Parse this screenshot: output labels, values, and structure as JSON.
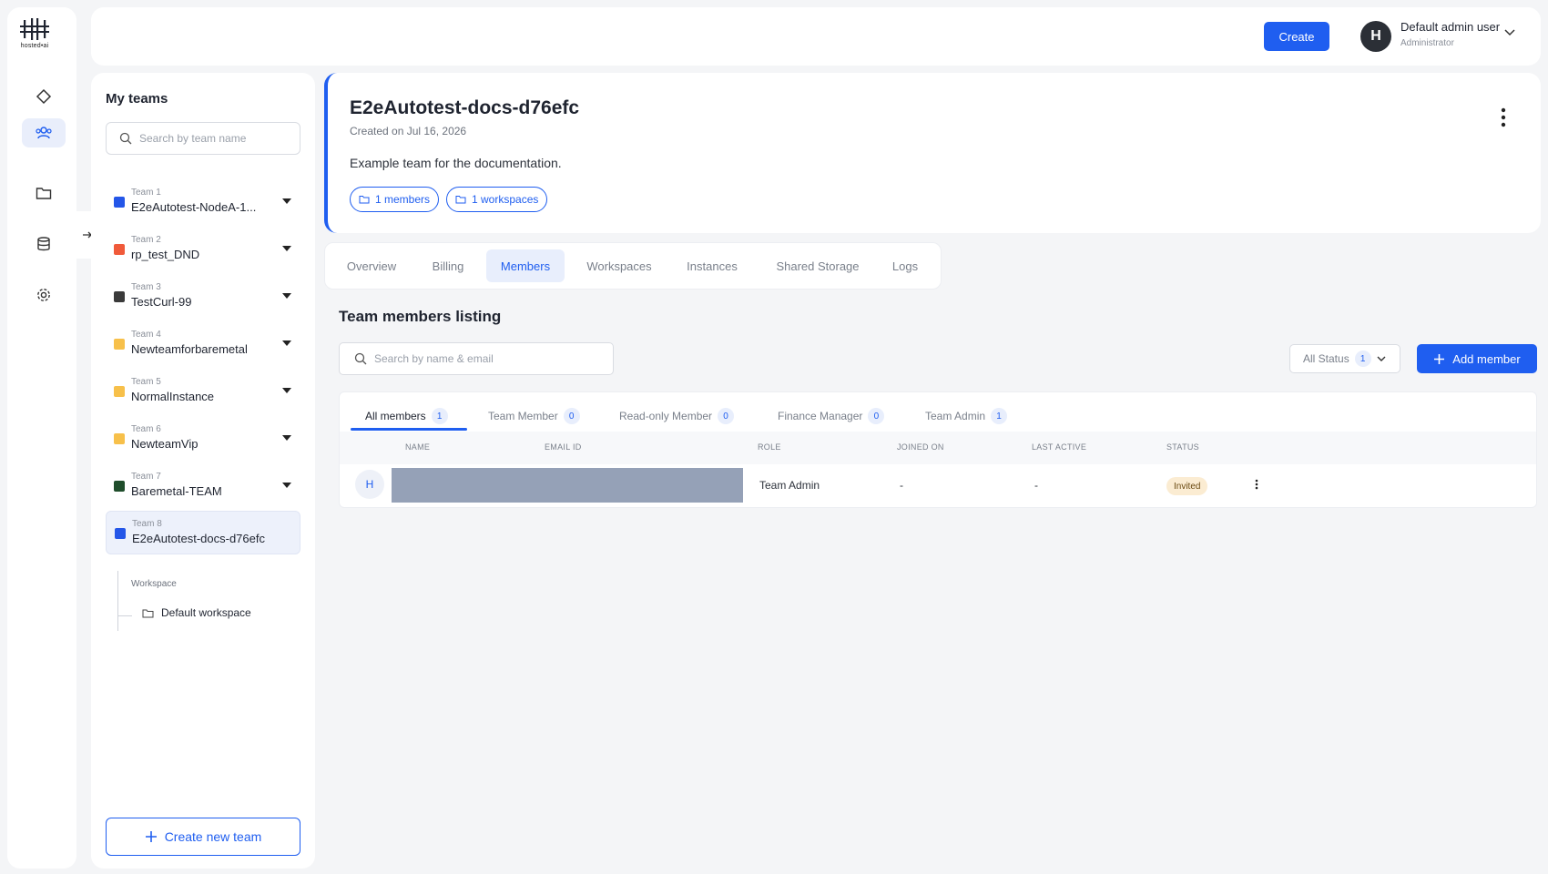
{
  "app": {
    "logo_text": "hosted•ai"
  },
  "rail": {
    "items": [
      {
        "icon": "diamond-icon"
      },
      {
        "icon": "users-icon",
        "active": true
      },
      {
        "icon": "folder-icon"
      },
      {
        "icon": "storage-icon"
      },
      {
        "icon": "gear-icon"
      }
    ]
  },
  "header": {
    "create_label": "Create",
    "avatar_initial": "H",
    "user_name": "Default admin user",
    "user_role": "Administrator"
  },
  "teams_panel": {
    "title": "My teams",
    "search_placeholder": "Search by team name",
    "teams": [
      {
        "label": "Team 1",
        "name": "E2eAutotest-NodeA-1...",
        "color": "#2456e8"
      },
      {
        "label": "Team 2",
        "name": "rp_test_DND",
        "color": "#f05a3a"
      },
      {
        "label": "Team 3",
        "name": "TestCurl-99",
        "color": "#3a3a3a"
      },
      {
        "label": "Team 4",
        "name": "Newteamforbaremetal",
        "color": "#f7c04a"
      },
      {
        "label": "Team 5",
        "name": "NormalInstance",
        "color": "#f7c04a"
      },
      {
        "label": "Team 6",
        "name": "NewteamVip",
        "color": "#f7c04a"
      },
      {
        "label": "Team 7",
        "name": "Baremetal-TEAM",
        "color": "#1f4d2b"
      },
      {
        "label": "Team 8",
        "name": "E2eAutotest-docs-d76efc",
        "color": "#2456e8",
        "active": true
      }
    ],
    "workspace_label": "Workspace",
    "workspace_item": "Default workspace",
    "create_team_label": "Create new team"
  },
  "team_card": {
    "title": "E2eAutotest-docs-d76efc",
    "created": "Created on Jul 16, 2026",
    "description": "Example team for the documentation.",
    "members_pill": "1 members",
    "workspaces_pill": "1 workspaces"
  },
  "tabs": [
    "Overview",
    "Billing",
    "Members",
    "Workspaces",
    "Instances",
    "Shared Storage",
    "Logs"
  ],
  "active_tab": "Members",
  "members": {
    "title": "Team members listing",
    "search_placeholder": "Search by name & email",
    "status_filter": {
      "label": "All Status",
      "count": "1"
    },
    "add_member_label": "Add member",
    "subtabs": [
      {
        "label": "All members",
        "count": "1"
      },
      {
        "label": "Team Member",
        "count": "0"
      },
      {
        "label": "Read-only Member",
        "count": "0"
      },
      {
        "label": "Finance Manager",
        "count": "0"
      },
      {
        "label": "Team Admin",
        "count": "1"
      }
    ],
    "columns": [
      "NAME",
      "EMAIL ID",
      "ROLE",
      "JOINED ON",
      "LAST ACTIVE",
      "STATUS"
    ],
    "rows": [
      {
        "avatar": "H",
        "role": "Team Admin",
        "joined": "-",
        "last_active": "-",
        "status": "Invited"
      }
    ]
  },
  "colors": {
    "accent": "#1f5ef0",
    "invited_badge": "#fbecd2"
  }
}
